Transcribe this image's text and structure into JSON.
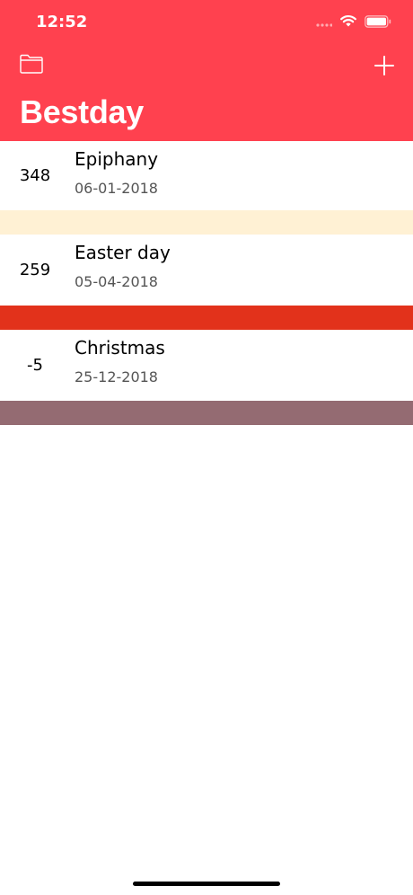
{
  "status_bar": {
    "time": "12:52"
  },
  "header": {
    "title": "Bestday",
    "left_icon": "folder-icon",
    "right_icon": "plus-icon",
    "background": "#ff414f"
  },
  "events": [
    {
      "days": "348",
      "name": "Epiphany",
      "date": "06-01-2018",
      "color": "#fff1d4"
    },
    {
      "days": "259",
      "name": "Easter day",
      "date": "05-04-2018",
      "color": "#e2321b"
    },
    {
      "days": "-5",
      "name": "Christmas",
      "date": "25-12-2018",
      "color": "#946b72"
    }
  ]
}
